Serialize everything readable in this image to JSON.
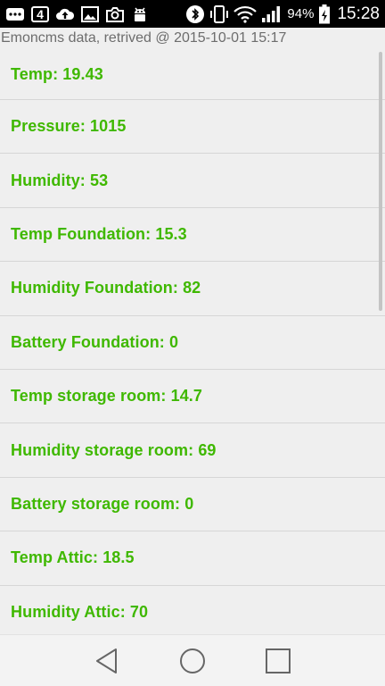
{
  "status_bar": {
    "notification_icons": [
      "message-icon",
      "badge-4-icon",
      "cloud-upload-icon",
      "image-icon",
      "camera-icon",
      "android-debug-icon"
    ],
    "badge_number": "4",
    "battery_percent": "94%",
    "time": "15:28"
  },
  "header": {
    "title": "Emoncms data, retrived @ 2015-10-01 15:17"
  },
  "list": {
    "items": [
      {
        "label": "Temp: 19.43"
      },
      {
        "label": "Pressure: 1015"
      },
      {
        "label": "Humidity: 53"
      },
      {
        "label": "Temp Foundation: 15.3"
      },
      {
        "label": "Humidity Foundation: 82"
      },
      {
        "label": "Battery Foundation: 0"
      },
      {
        "label": "Temp storage room: 14.7"
      },
      {
        "label": "Humidity storage room: 69"
      },
      {
        "label": "Battery storage room: 0"
      },
      {
        "label": "Temp Attic: 18.5"
      },
      {
        "label": "Humidity Attic: 70"
      }
    ]
  },
  "nav_bar": {
    "buttons": [
      "back-icon",
      "home-icon",
      "recents-icon"
    ]
  },
  "colors": {
    "item_text": "#3fb800",
    "background": "#efefef",
    "status_bar": "#000000"
  }
}
